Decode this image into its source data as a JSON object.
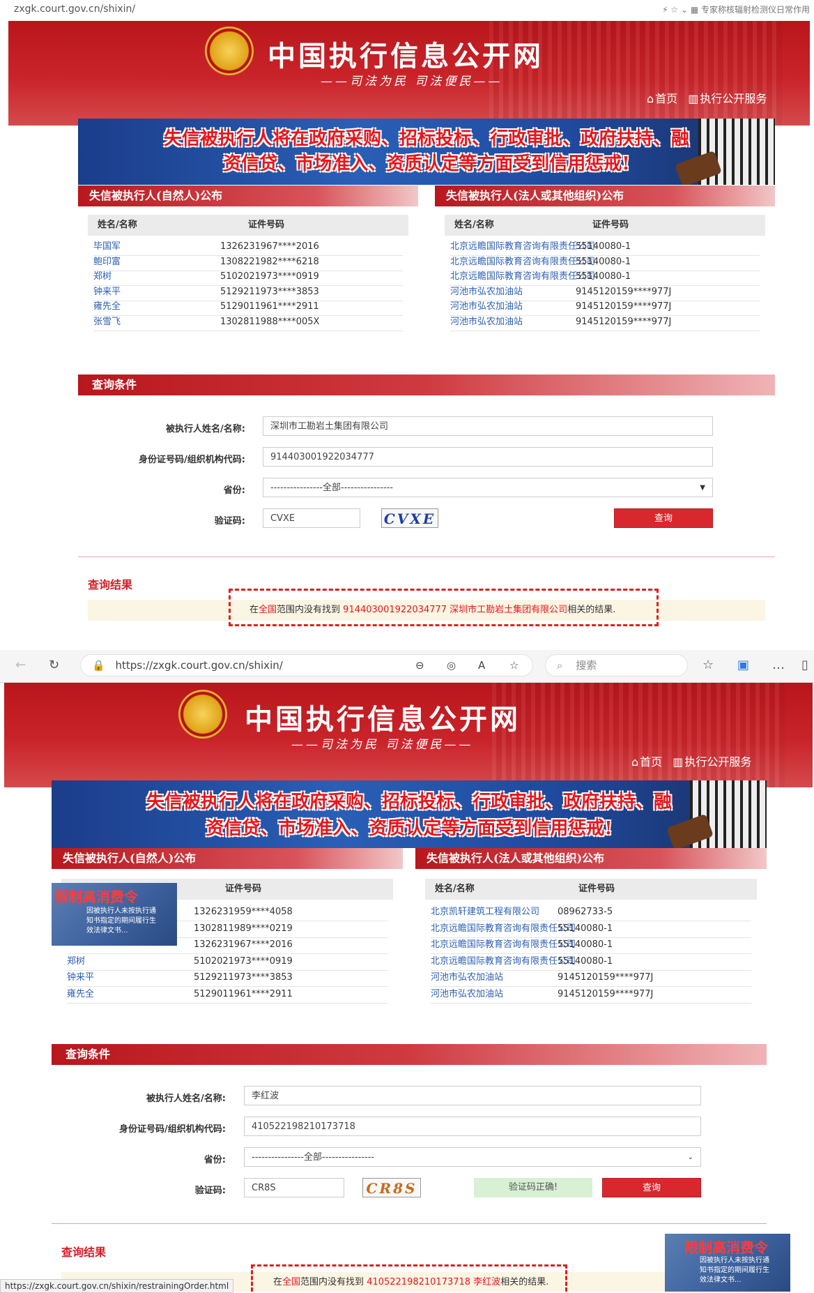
{
  "top_browser": {
    "url": "zxgk.court.gov.cn/shixin/",
    "right_text": "专家称核辐射检测仪日常作用"
  },
  "site": {
    "title": "中国执行信息公开网",
    "slogan": "——司法为民  司法便民——",
    "nav_home": "首页",
    "nav_service": "执行公开服务"
  },
  "banner": {
    "line1": "失信被执行人将在政府采购、招标投标、行政审批、政府扶持、融",
    "line2": "资信贷、市场准入、资质认定等方面受到信用惩戒!"
  },
  "panels": {
    "natural_title": "失信被执行人(自然人)公布",
    "legal_title": "失信被执行人(法人或其他组织)公布",
    "col_name": "姓名/名称",
    "col_id": "证件号码"
  },
  "shot1": {
    "natural_rows": [
      {
        "name": "毕国军",
        "id": "1326231967****2016"
      },
      {
        "name": "鲍印富",
        "id": "1308221982****6218"
      },
      {
        "name": "郑树",
        "id": "5102021973****0919"
      },
      {
        "name": "钟来平",
        "id": "5129211973****3853"
      },
      {
        "name": "雍先全",
        "id": "5129011961****2911"
      },
      {
        "name": "张雪飞",
        "id": "1302811988****005X"
      }
    ],
    "legal_rows": [
      {
        "name": "北京远瞻国际教育咨询有限责任公司",
        "id": "55140080-1"
      },
      {
        "name": "北京远瞻国际教育咨询有限责任公司",
        "id": "55140080-1"
      },
      {
        "name": "北京远瞻国际教育咨询有限责任公司",
        "id": "55140080-1"
      },
      {
        "name": "河池市弘农加油站",
        "id": "9145120159****977J"
      },
      {
        "name": "河池市弘农加油站",
        "id": "9145120159****977J"
      },
      {
        "name": "河池市弘农加油站",
        "id": "9145120159****977J"
      }
    ],
    "query": {
      "bar_title": "查询条件",
      "label_name": "被执行人姓名/名称:",
      "label_id": "身份证号码/组织机构代码:",
      "label_province": "省份:",
      "label_captcha": "验证码:",
      "value_name": "深圳市工勘岩土集团有限公司",
      "value_id": "914403001922034777",
      "value_province": "----------------全部----------------",
      "value_captcha": "CVXE",
      "captcha_image_text": "CVXE",
      "button": "查询"
    },
    "result": {
      "title": "查询结果",
      "msg_a": "在",
      "msg_scope": "全国",
      "msg_b": "范围内没有找到 ",
      "msg_keys": "914403001922034777 深圳市工勘岩土集团有限公司",
      "msg_c": "相关的结果."
    }
  },
  "browser2": {
    "url": "https://zxgk.court.gov.cn/shixin/",
    "search_placeholder": "搜索"
  },
  "shot2": {
    "natural_rows": [
      {
        "name": "",
        "id": "1326231959****4058"
      },
      {
        "name": "",
        "id": "1302811989****0219"
      },
      {
        "name": "",
        "id": "1326231967****2016"
      },
      {
        "name": "郑树",
        "id": "5102021973****0919"
      },
      {
        "name": "钟来平",
        "id": "5129211973****3853"
      },
      {
        "name": "雍先全",
        "id": "5129011961****2911"
      }
    ],
    "legal_rows": [
      {
        "name": "北京凯轩建筑工程有限公司",
        "id": "08962733-5"
      },
      {
        "name": "北京远瞻国际教育咨询有限责任公司",
        "id": "55140080-1"
      },
      {
        "name": "北京远瞻国际教育咨询有限责任公司",
        "id": "55140080-1"
      },
      {
        "name": "北京远瞻国际教育咨询有限责任公司",
        "id": "55140080-1"
      },
      {
        "name": "河池市弘农加油站",
        "id": "9145120159****977J"
      },
      {
        "name": "河池市弘农加油站",
        "id": "9145120159****977J"
      }
    ],
    "promo": {
      "title": "限制高消费令",
      "text1": "因被执行人未按执行通",
      "text2": "知书指定的期间履行生",
      "text3": "效法律文书..."
    },
    "query": {
      "bar_title": "查询条件",
      "label_name": "被执行人姓名/名称:",
      "label_id": "身份证号码/组织机构代码:",
      "label_province": "省份:",
      "label_captcha": "验证码:",
      "value_name": "李红波",
      "value_id": "410522198210173718",
      "value_province": "----------------全部----------------",
      "value_captcha": "CR8S",
      "captcha_image_text": "CR8S",
      "captcha_ok": "验证码正确!",
      "button": "查询"
    },
    "result": {
      "title": "查询结果",
      "msg_a": "在",
      "msg_scope": "全国",
      "msg_b": "范围内没有找到 ",
      "msg_keys": "410522198210173718 李红波",
      "msg_c": "相关的结果."
    },
    "status_url": "https://zxgk.court.gov.cn/shixin/restrainingOrder.html"
  }
}
